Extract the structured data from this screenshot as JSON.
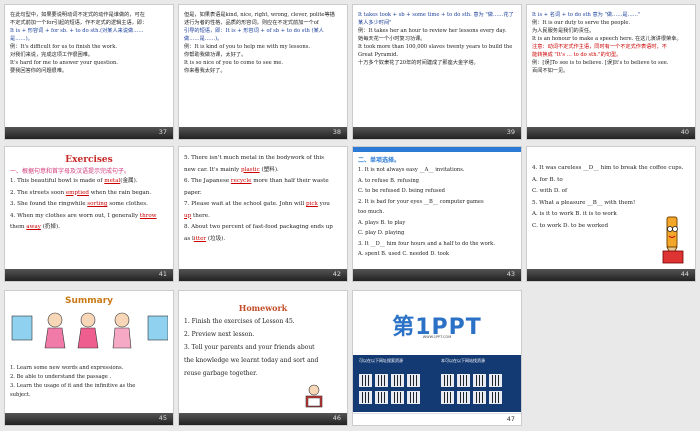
{
  "slides": [
    {
      "num": "37",
      "lines": [
        "在此句型中，如果要说明动词不定式的动作是谁做的，可在",
        "不定式前加一个for引起的短语，作不定式的逻辑主语，即：",
        "It is + 形容词 + for sb. + to do sth.(对某人来说做……",
        "是……)。",
        "例：It's difficult for us to finish the work.",
        "    对我们来说，完成这项工作很困难。",
        "    It's hard for me to answer your question.",
        "    要我回答你的问题很难。"
      ]
    },
    {
      "num": "38",
      "lines": [
        "但是，如果表语是kind, nice, right, wrong, clever, polite等描",
        "述行为者的性格、品质的形容词，则应在不定式前加一个of",
        "引导的短语，即：It is + 形容词 + of sb + to do sth (某人",
        "做……是……)。",
        "例：It is kind of you to help me with my lessons.",
        "    你帮助我做功课，太好了。",
        "    It is so nice of you to come to see me.",
        "    你来看我太好了。"
      ]
    },
    {
      "num": "39",
      "lines": [
        "It takes took + sb + some time + to do sth. 意为 \"做……花了",
        "某人多少时间\"",
        "例：It takes her an hour to review her lessons every day.",
        "    她每天花一个小时复习功课。",
        "    It took more than 100,000 slaves twenty years to build the",
        "    Great Pyramid.",
        "    十万多个奴隶花了20年的时间建成了那座大金字塔。"
      ]
    },
    {
      "num": "40",
      "lines": [
        "It is + 名词 + to do sth 意为 \"做……是……\"",
        "例：It is our duty to serve the people.",
        "    为人民服务是我们的责任。",
        "    It is an honour to make a speech here. 在这儿演讲很荣幸。",
        "注意：动词不定式作主语，同时有一个不定式作表语时，不",
        "    能转换成 \"It's … to do sth.\"的句型。",
        "例：[误]To see is to believe.  [误]It's to believe to see.",
        "    百闻不如一见。"
      ]
    },
    {
      "num": "41",
      "title": "Exercises",
      "subtitle": "一、根据句意和首字母及汉语提示完成句子。",
      "items": [
        {
          "pre": "1. This beautiful bowl is made of ",
          "ans": "metal",
          "post": "(金属)."
        },
        {
          "pre": "2. The streets soon ",
          "ans": "emptied",
          "post": " when the rain began."
        },
        {
          "pre": "3. She found the ringwhile ",
          "ans": "sorting",
          "post": " some clothes."
        },
        {
          "pre": "4. When my clothes are worn out, I generally ",
          "ans": "throw",
          "post": ""
        },
        {
          "pre": "   them ",
          "ans": "away",
          "post": " (扔掉)."
        }
      ]
    },
    {
      "num": "42",
      "items": [
        {
          "pre": "5. There isn't much metal in the bodywork of this",
          "ans": "",
          "post": ""
        },
        {
          "pre": "new car. It's mainly ",
          "ans": "plastic",
          "post": " (塑料)."
        },
        {
          "pre": "6. The Japanese ",
          "ans": "recycle",
          "post": " more than half their waste"
        },
        {
          "pre": "paper.",
          "ans": "",
          "post": ""
        },
        {
          "pre": "7. Please wait at the school gate. John will ",
          "ans": "pick",
          "post": " you"
        },
        {
          "pre": "",
          "ans": "up",
          "post": " there."
        },
        {
          "pre": "8. About two percent of fast-food packaging ends up",
          "ans": "",
          "post": ""
        },
        {
          "pre": "as l",
          "ans": "itter",
          "post": " (垃圾)."
        }
      ]
    },
    {
      "num": "43",
      "title": "二、单项选择。",
      "lines": [
        "1. It is not always easy __A__ invitations.",
        "   A. to refuse          B. refusing",
        "   C. to be refused      D. being refused",
        "2. It is bad for your eyes __B__ computer games",
        "   too much.",
        "   A. plays              B. to play",
        "   C. play               D. playing",
        "3. It __D__ him four hours and a half to do the work.",
        "   A. spent   B. used   C. needed   D. took"
      ]
    },
    {
      "num": "44",
      "lines": [
        "4. It was careless __D__ him to break the coffee cups.",
        "   A. for          B. to",
        "   C. with         D. of",
        "5. What a pleasure __B__ with them!",
        "   A. is it to work      B. it is to work",
        "   C. to work            D. to be worked"
      ]
    },
    {
      "num": "45",
      "title": "Summary",
      "lines": [
        "1. Learn some new words and expressions.",
        "2. Be able to understand the passage .",
        "3. Learn the usage of it and the infinitive as the",
        "   subject."
      ]
    },
    {
      "num": "46",
      "title": "Homework",
      "lines": [
        "1. Finish the exercises of Lesson 45.",
        "2. Preview next lesson.",
        "3. Tell your parents and your friends about",
        "the knowledge we learnt today and sort and",
        "reuse garbage together."
      ]
    },
    {
      "num": "47",
      "logo": "第1PPT",
      "logo_sub": "WWW.1PPT.COM",
      "promo_left": "可以在以下网址搜索资源",
      "promo_right": "本可以在以下网站找资源"
    }
  ]
}
